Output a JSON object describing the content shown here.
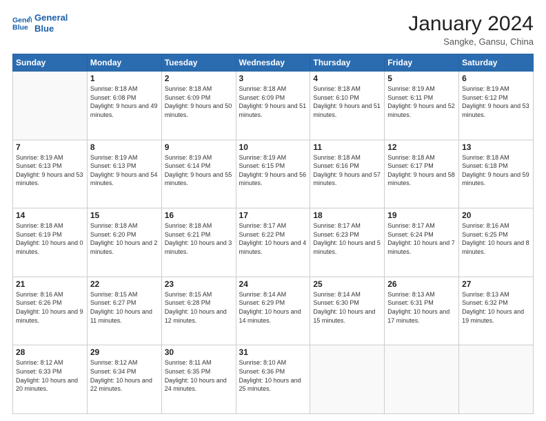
{
  "header": {
    "logo_line1": "General",
    "logo_line2": "Blue",
    "month_title": "January 2024",
    "location": "Sangke, Gansu, China"
  },
  "weekdays": [
    "Sunday",
    "Monday",
    "Tuesday",
    "Wednesday",
    "Thursday",
    "Friday",
    "Saturday"
  ],
  "weeks": [
    [
      {
        "day": "",
        "sunrise": "",
        "sunset": "",
        "daylight": ""
      },
      {
        "day": "1",
        "sunrise": "Sunrise: 8:18 AM",
        "sunset": "Sunset: 6:08 PM",
        "daylight": "Daylight: 9 hours and 49 minutes."
      },
      {
        "day": "2",
        "sunrise": "Sunrise: 8:18 AM",
        "sunset": "Sunset: 6:09 PM",
        "daylight": "Daylight: 9 hours and 50 minutes."
      },
      {
        "day": "3",
        "sunrise": "Sunrise: 8:18 AM",
        "sunset": "Sunset: 6:09 PM",
        "daylight": "Daylight: 9 hours and 51 minutes."
      },
      {
        "day": "4",
        "sunrise": "Sunrise: 8:18 AM",
        "sunset": "Sunset: 6:10 PM",
        "daylight": "Daylight: 9 hours and 51 minutes."
      },
      {
        "day": "5",
        "sunrise": "Sunrise: 8:19 AM",
        "sunset": "Sunset: 6:11 PM",
        "daylight": "Daylight: 9 hours and 52 minutes."
      },
      {
        "day": "6",
        "sunrise": "Sunrise: 8:19 AM",
        "sunset": "Sunset: 6:12 PM",
        "daylight": "Daylight: 9 hours and 53 minutes."
      }
    ],
    [
      {
        "day": "7",
        "sunrise": "Sunrise: 8:19 AM",
        "sunset": "Sunset: 6:13 PM",
        "daylight": "Daylight: 9 hours and 53 minutes."
      },
      {
        "day": "8",
        "sunrise": "Sunrise: 8:19 AM",
        "sunset": "Sunset: 6:13 PM",
        "daylight": "Daylight: 9 hours and 54 minutes."
      },
      {
        "day": "9",
        "sunrise": "Sunrise: 8:19 AM",
        "sunset": "Sunset: 6:14 PM",
        "daylight": "Daylight: 9 hours and 55 minutes."
      },
      {
        "day": "10",
        "sunrise": "Sunrise: 8:19 AM",
        "sunset": "Sunset: 6:15 PM",
        "daylight": "Daylight: 9 hours and 56 minutes."
      },
      {
        "day": "11",
        "sunrise": "Sunrise: 8:18 AM",
        "sunset": "Sunset: 6:16 PM",
        "daylight": "Daylight: 9 hours and 57 minutes."
      },
      {
        "day": "12",
        "sunrise": "Sunrise: 8:18 AM",
        "sunset": "Sunset: 6:17 PM",
        "daylight": "Daylight: 9 hours and 58 minutes."
      },
      {
        "day": "13",
        "sunrise": "Sunrise: 8:18 AM",
        "sunset": "Sunset: 6:18 PM",
        "daylight": "Daylight: 9 hours and 59 minutes."
      }
    ],
    [
      {
        "day": "14",
        "sunrise": "Sunrise: 8:18 AM",
        "sunset": "Sunset: 6:19 PM",
        "daylight": "Daylight: 10 hours and 0 minutes."
      },
      {
        "day": "15",
        "sunrise": "Sunrise: 8:18 AM",
        "sunset": "Sunset: 6:20 PM",
        "daylight": "Daylight: 10 hours and 2 minutes."
      },
      {
        "day": "16",
        "sunrise": "Sunrise: 8:18 AM",
        "sunset": "Sunset: 6:21 PM",
        "daylight": "Daylight: 10 hours and 3 minutes."
      },
      {
        "day": "17",
        "sunrise": "Sunrise: 8:17 AM",
        "sunset": "Sunset: 6:22 PM",
        "daylight": "Daylight: 10 hours and 4 minutes."
      },
      {
        "day": "18",
        "sunrise": "Sunrise: 8:17 AM",
        "sunset": "Sunset: 6:23 PM",
        "daylight": "Daylight: 10 hours and 5 minutes."
      },
      {
        "day": "19",
        "sunrise": "Sunrise: 8:17 AM",
        "sunset": "Sunset: 6:24 PM",
        "daylight": "Daylight: 10 hours and 7 minutes."
      },
      {
        "day": "20",
        "sunrise": "Sunrise: 8:16 AM",
        "sunset": "Sunset: 6:25 PM",
        "daylight": "Daylight: 10 hours and 8 minutes."
      }
    ],
    [
      {
        "day": "21",
        "sunrise": "Sunrise: 8:16 AM",
        "sunset": "Sunset: 6:26 PM",
        "daylight": "Daylight: 10 hours and 9 minutes."
      },
      {
        "day": "22",
        "sunrise": "Sunrise: 8:15 AM",
        "sunset": "Sunset: 6:27 PM",
        "daylight": "Daylight: 10 hours and 11 minutes."
      },
      {
        "day": "23",
        "sunrise": "Sunrise: 8:15 AM",
        "sunset": "Sunset: 6:28 PM",
        "daylight": "Daylight: 10 hours and 12 minutes."
      },
      {
        "day": "24",
        "sunrise": "Sunrise: 8:14 AM",
        "sunset": "Sunset: 6:29 PM",
        "daylight": "Daylight: 10 hours and 14 minutes."
      },
      {
        "day": "25",
        "sunrise": "Sunrise: 8:14 AM",
        "sunset": "Sunset: 6:30 PM",
        "daylight": "Daylight: 10 hours and 15 minutes."
      },
      {
        "day": "26",
        "sunrise": "Sunrise: 8:13 AM",
        "sunset": "Sunset: 6:31 PM",
        "daylight": "Daylight: 10 hours and 17 minutes."
      },
      {
        "day": "27",
        "sunrise": "Sunrise: 8:13 AM",
        "sunset": "Sunset: 6:32 PM",
        "daylight": "Daylight: 10 hours and 19 minutes."
      }
    ],
    [
      {
        "day": "28",
        "sunrise": "Sunrise: 8:12 AM",
        "sunset": "Sunset: 6:33 PM",
        "daylight": "Daylight: 10 hours and 20 minutes."
      },
      {
        "day": "29",
        "sunrise": "Sunrise: 8:12 AM",
        "sunset": "Sunset: 6:34 PM",
        "daylight": "Daylight: 10 hours and 22 minutes."
      },
      {
        "day": "30",
        "sunrise": "Sunrise: 8:11 AM",
        "sunset": "Sunset: 6:35 PM",
        "daylight": "Daylight: 10 hours and 24 minutes."
      },
      {
        "day": "31",
        "sunrise": "Sunrise: 8:10 AM",
        "sunset": "Sunset: 6:36 PM",
        "daylight": "Daylight: 10 hours and 25 minutes."
      },
      {
        "day": "",
        "sunrise": "",
        "sunset": "",
        "daylight": ""
      },
      {
        "day": "",
        "sunrise": "",
        "sunset": "",
        "daylight": ""
      },
      {
        "day": "",
        "sunrise": "",
        "sunset": "",
        "daylight": ""
      }
    ]
  ]
}
